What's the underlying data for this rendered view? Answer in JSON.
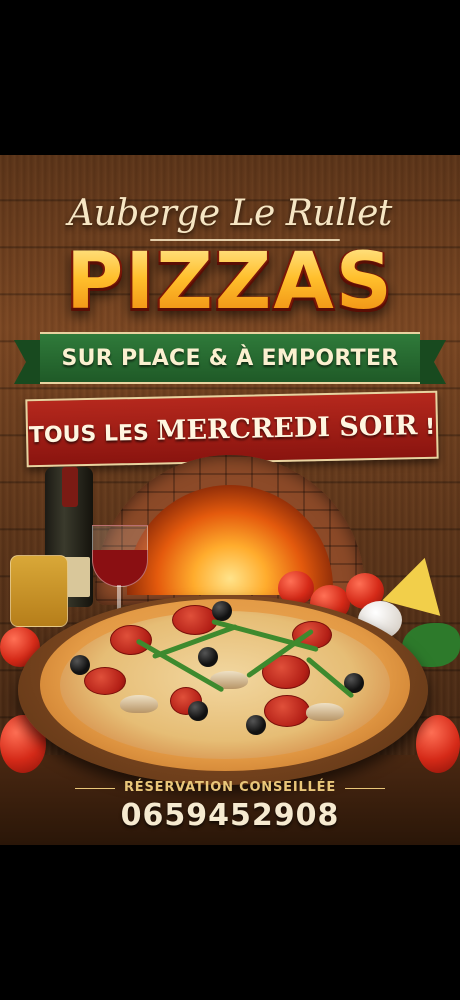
{
  "poster": {
    "venue_name": "Auberge Le Rullet",
    "headline": "PIZZAS",
    "service_banner": "SUR PLACE & À EMPORTER",
    "schedule_banner_prefix": "TOUS LES",
    "schedule_banner_day": "MERCREDI SOIR",
    "schedule_banner_suffix": "!",
    "reservation_note": "RÉSERVATION CONSEILLÉE",
    "phone_number": "0659452908"
  },
  "colors": {
    "background": "#000000",
    "headline": "#ffbf2c",
    "green_ribbon": "#2f7a3a",
    "red_ribbon": "#b5281d",
    "accent_text": "#e9c77a"
  },
  "icons": [
    "wine-bottle-icon",
    "wine-glass-icon",
    "olive-oil-icon",
    "pizza-icon",
    "tomato-icon",
    "cheese-icon",
    "garlic-icon",
    "basil-icon",
    "wood-oven-icon"
  ]
}
